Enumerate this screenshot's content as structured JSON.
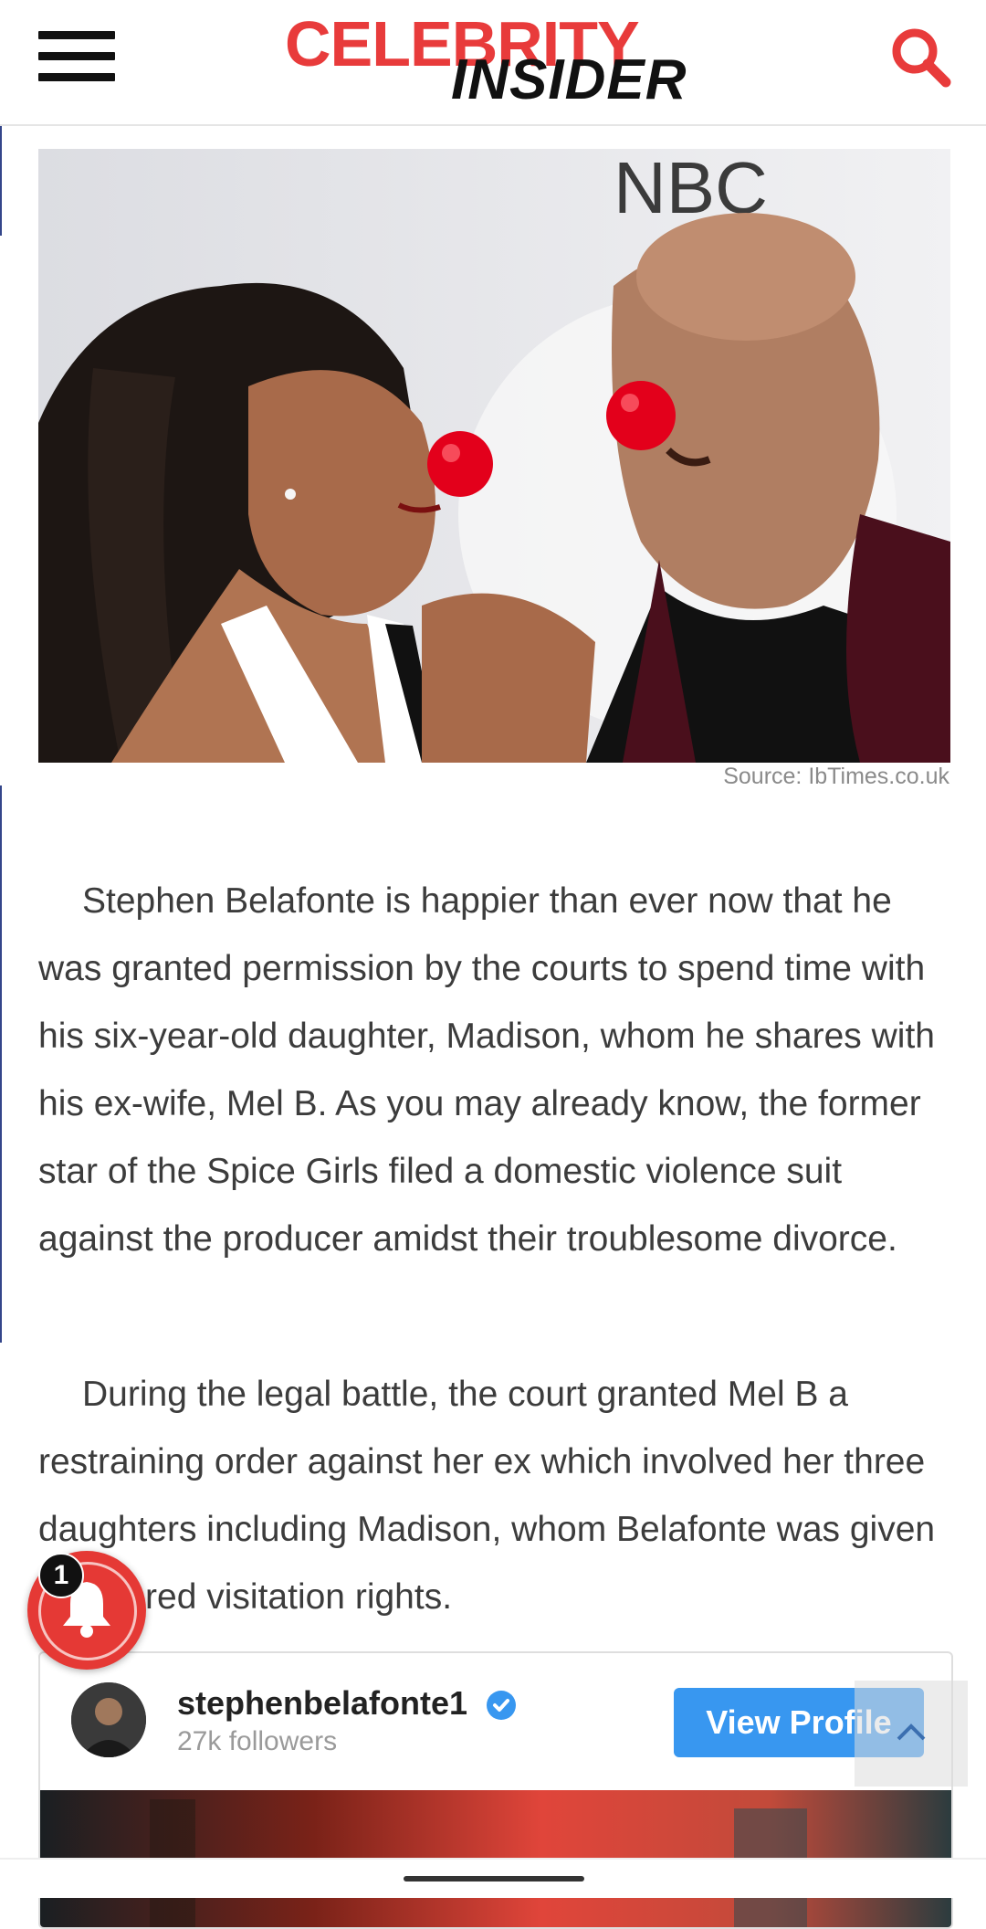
{
  "header": {
    "logo_top": "CELEBRITY",
    "logo_bottom": "INSIDER",
    "brand_color": "#e83b3b"
  },
  "article": {
    "image_caption": "Source: IbTimes.co.uk",
    "paragraphs": [
      "Stephen Belafonte is happier than ever now that he was granted permission by the courts to spend time with his six-year-old daughter, Madison, whom he shares with his ex-wife, Mel B. As you may already know, the former star of the Spice Girls filed a domestic violence suit against the producer amidst their troublesome divorce.",
      "During the legal battle, the court granted Mel B a restraining order against her ex which involved her three daughters including Madison, whom Belafonte was given monitored visitation rights."
    ]
  },
  "instagram_embed": {
    "username": "stephenbelafonte1",
    "followers": "27k followers",
    "view_profile_label": "View Profile",
    "button_color": "#3897f0"
  },
  "notification": {
    "badge_count": "1",
    "color": "#e53935"
  }
}
